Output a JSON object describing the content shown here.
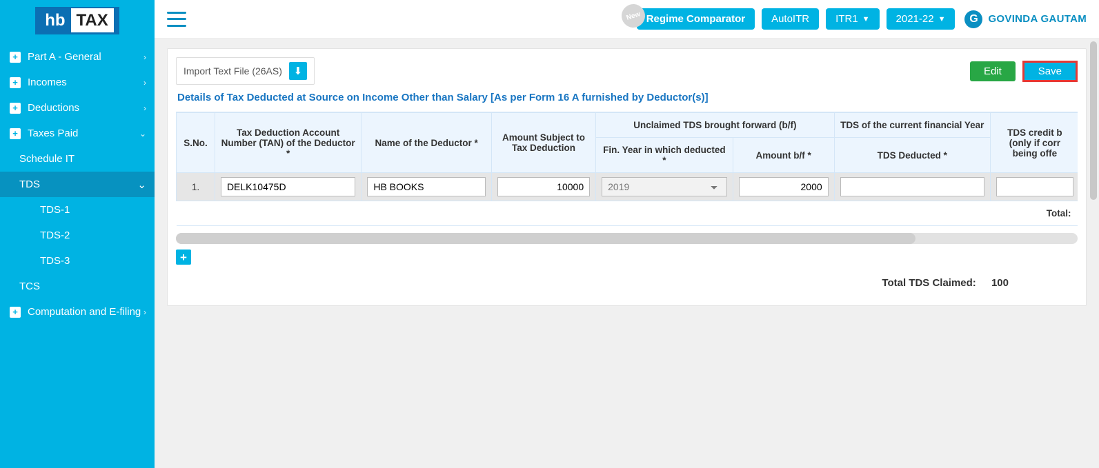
{
  "logo": {
    "hb": "hb",
    "tax": "TAX"
  },
  "sidebar": {
    "items": [
      {
        "label": "Part A - General",
        "icon": "+",
        "chev": "›"
      },
      {
        "label": "Incomes",
        "icon": "+",
        "chev": "›"
      },
      {
        "label": "Deductions",
        "icon": "+",
        "chev": "›"
      },
      {
        "label": "Taxes Paid",
        "icon": "+",
        "chev": "⌄"
      }
    ],
    "subs": {
      "schedule_it": "Schedule IT",
      "tds": "TDS",
      "tds_chev": "⌄",
      "tds1": "TDS-1",
      "tds2": "TDS-2",
      "tds3": "TDS-3",
      "tcs": "TCS"
    },
    "computation": {
      "label": "Computation and E-filing",
      "icon": "+",
      "chev": "›"
    }
  },
  "topbar": {
    "regime": "Regime Comparator",
    "new": "New",
    "autoitr": "AutoITR",
    "itr": "ITR1",
    "year": "2021-22",
    "avatar": "G",
    "user": "GOVINDA GAUTAM"
  },
  "toolbar": {
    "import_label": "Import Text File (26AS)",
    "edit": "Edit",
    "save": "Save"
  },
  "section_title": "Details of Tax Deducted at Source on Income Other than Salary [As per Form 16 A furnished by Deductor(s)]",
  "table": {
    "headers": {
      "sno": "S.No.",
      "tan": "Tax Deduction Account Number (TAN) of the Deductor *",
      "name": "Name of the Deductor *",
      "amount_subject": "Amount Subject to Tax Deduction",
      "unclaimed": "Unclaimed TDS brought forward (b/f)",
      "tds_current": "TDS of the current financial Year",
      "tds_credit": "TDS credit being claimed this Year (only if corresponding income is being offered for tax this year)",
      "fin_year": "Fin. Year in which deducted *",
      "amount_bf": "Amount b/f *",
      "tds_deducted": "TDS Deducted *",
      "tds_partial": "TDS"
    },
    "rows": [
      {
        "sno": "1.",
        "tan": "DELK10475D",
        "name": "HB BOOKS",
        "amount": "10000",
        "fy": "2019",
        "bf": "2000",
        "ded": ""
      }
    ],
    "total_label": "Total:"
  },
  "footer": {
    "label": "Total TDS Claimed:",
    "value": "100"
  }
}
